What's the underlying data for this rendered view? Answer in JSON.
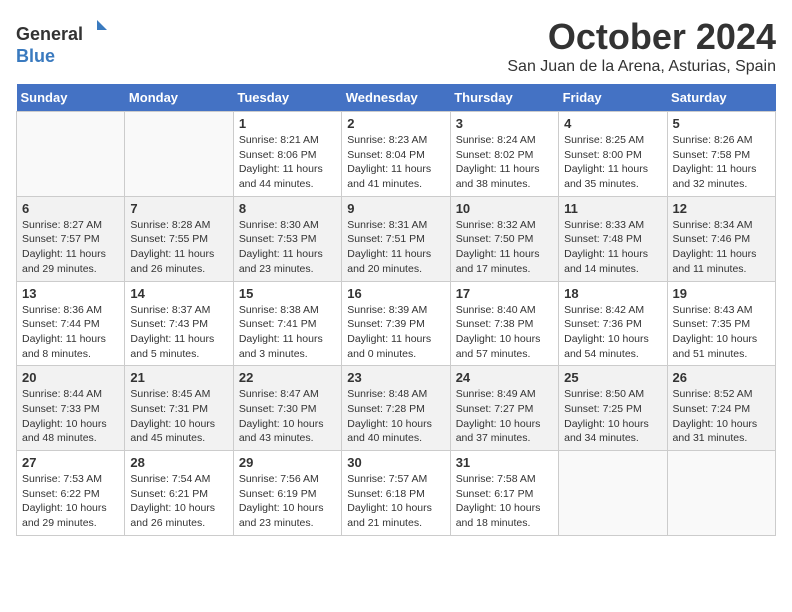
{
  "header": {
    "logo_line1": "General",
    "logo_line2": "Blue",
    "month_title": "October 2024",
    "subtitle": "San Juan de la Arena, Asturias, Spain"
  },
  "days_of_week": [
    "Sunday",
    "Monday",
    "Tuesday",
    "Wednesday",
    "Thursday",
    "Friday",
    "Saturday"
  ],
  "weeks": [
    [
      {
        "day": "",
        "sunrise": "",
        "sunset": "",
        "daylight": ""
      },
      {
        "day": "",
        "sunrise": "",
        "sunset": "",
        "daylight": ""
      },
      {
        "day": "1",
        "sunrise": "Sunrise: 8:21 AM",
        "sunset": "Sunset: 8:06 PM",
        "daylight": "Daylight: 11 hours and 44 minutes."
      },
      {
        "day": "2",
        "sunrise": "Sunrise: 8:23 AM",
        "sunset": "Sunset: 8:04 PM",
        "daylight": "Daylight: 11 hours and 41 minutes."
      },
      {
        "day": "3",
        "sunrise": "Sunrise: 8:24 AM",
        "sunset": "Sunset: 8:02 PM",
        "daylight": "Daylight: 11 hours and 38 minutes."
      },
      {
        "day": "4",
        "sunrise": "Sunrise: 8:25 AM",
        "sunset": "Sunset: 8:00 PM",
        "daylight": "Daylight: 11 hours and 35 minutes."
      },
      {
        "day": "5",
        "sunrise": "Sunrise: 8:26 AM",
        "sunset": "Sunset: 7:58 PM",
        "daylight": "Daylight: 11 hours and 32 minutes."
      }
    ],
    [
      {
        "day": "6",
        "sunrise": "Sunrise: 8:27 AM",
        "sunset": "Sunset: 7:57 PM",
        "daylight": "Daylight: 11 hours and 29 minutes."
      },
      {
        "day": "7",
        "sunrise": "Sunrise: 8:28 AM",
        "sunset": "Sunset: 7:55 PM",
        "daylight": "Daylight: 11 hours and 26 minutes."
      },
      {
        "day": "8",
        "sunrise": "Sunrise: 8:30 AM",
        "sunset": "Sunset: 7:53 PM",
        "daylight": "Daylight: 11 hours and 23 minutes."
      },
      {
        "day": "9",
        "sunrise": "Sunrise: 8:31 AM",
        "sunset": "Sunset: 7:51 PM",
        "daylight": "Daylight: 11 hours and 20 minutes."
      },
      {
        "day": "10",
        "sunrise": "Sunrise: 8:32 AM",
        "sunset": "Sunset: 7:50 PM",
        "daylight": "Daylight: 11 hours and 17 minutes."
      },
      {
        "day": "11",
        "sunrise": "Sunrise: 8:33 AM",
        "sunset": "Sunset: 7:48 PM",
        "daylight": "Daylight: 11 hours and 14 minutes."
      },
      {
        "day": "12",
        "sunrise": "Sunrise: 8:34 AM",
        "sunset": "Sunset: 7:46 PM",
        "daylight": "Daylight: 11 hours and 11 minutes."
      }
    ],
    [
      {
        "day": "13",
        "sunrise": "Sunrise: 8:36 AM",
        "sunset": "Sunset: 7:44 PM",
        "daylight": "Daylight: 11 hours and 8 minutes."
      },
      {
        "day": "14",
        "sunrise": "Sunrise: 8:37 AM",
        "sunset": "Sunset: 7:43 PM",
        "daylight": "Daylight: 11 hours and 5 minutes."
      },
      {
        "day": "15",
        "sunrise": "Sunrise: 8:38 AM",
        "sunset": "Sunset: 7:41 PM",
        "daylight": "Daylight: 11 hours and 3 minutes."
      },
      {
        "day": "16",
        "sunrise": "Sunrise: 8:39 AM",
        "sunset": "Sunset: 7:39 PM",
        "daylight": "Daylight: 11 hours and 0 minutes."
      },
      {
        "day": "17",
        "sunrise": "Sunrise: 8:40 AM",
        "sunset": "Sunset: 7:38 PM",
        "daylight": "Daylight: 10 hours and 57 minutes."
      },
      {
        "day": "18",
        "sunrise": "Sunrise: 8:42 AM",
        "sunset": "Sunset: 7:36 PM",
        "daylight": "Daylight: 10 hours and 54 minutes."
      },
      {
        "day": "19",
        "sunrise": "Sunrise: 8:43 AM",
        "sunset": "Sunset: 7:35 PM",
        "daylight": "Daylight: 10 hours and 51 minutes."
      }
    ],
    [
      {
        "day": "20",
        "sunrise": "Sunrise: 8:44 AM",
        "sunset": "Sunset: 7:33 PM",
        "daylight": "Daylight: 10 hours and 48 minutes."
      },
      {
        "day": "21",
        "sunrise": "Sunrise: 8:45 AM",
        "sunset": "Sunset: 7:31 PM",
        "daylight": "Daylight: 10 hours and 45 minutes."
      },
      {
        "day": "22",
        "sunrise": "Sunrise: 8:47 AM",
        "sunset": "Sunset: 7:30 PM",
        "daylight": "Daylight: 10 hours and 43 minutes."
      },
      {
        "day": "23",
        "sunrise": "Sunrise: 8:48 AM",
        "sunset": "Sunset: 7:28 PM",
        "daylight": "Daylight: 10 hours and 40 minutes."
      },
      {
        "day": "24",
        "sunrise": "Sunrise: 8:49 AM",
        "sunset": "Sunset: 7:27 PM",
        "daylight": "Daylight: 10 hours and 37 minutes."
      },
      {
        "day": "25",
        "sunrise": "Sunrise: 8:50 AM",
        "sunset": "Sunset: 7:25 PM",
        "daylight": "Daylight: 10 hours and 34 minutes."
      },
      {
        "day": "26",
        "sunrise": "Sunrise: 8:52 AM",
        "sunset": "Sunset: 7:24 PM",
        "daylight": "Daylight: 10 hours and 31 minutes."
      }
    ],
    [
      {
        "day": "27",
        "sunrise": "Sunrise: 7:53 AM",
        "sunset": "Sunset: 6:22 PM",
        "daylight": "Daylight: 10 hours and 29 minutes."
      },
      {
        "day": "28",
        "sunrise": "Sunrise: 7:54 AM",
        "sunset": "Sunset: 6:21 PM",
        "daylight": "Daylight: 10 hours and 26 minutes."
      },
      {
        "day": "29",
        "sunrise": "Sunrise: 7:56 AM",
        "sunset": "Sunset: 6:19 PM",
        "daylight": "Daylight: 10 hours and 23 minutes."
      },
      {
        "day": "30",
        "sunrise": "Sunrise: 7:57 AM",
        "sunset": "Sunset: 6:18 PM",
        "daylight": "Daylight: 10 hours and 21 minutes."
      },
      {
        "day": "31",
        "sunrise": "Sunrise: 7:58 AM",
        "sunset": "Sunset: 6:17 PM",
        "daylight": "Daylight: 10 hours and 18 minutes."
      },
      {
        "day": "",
        "sunrise": "",
        "sunset": "",
        "daylight": ""
      },
      {
        "day": "",
        "sunrise": "",
        "sunset": "",
        "daylight": ""
      }
    ]
  ]
}
